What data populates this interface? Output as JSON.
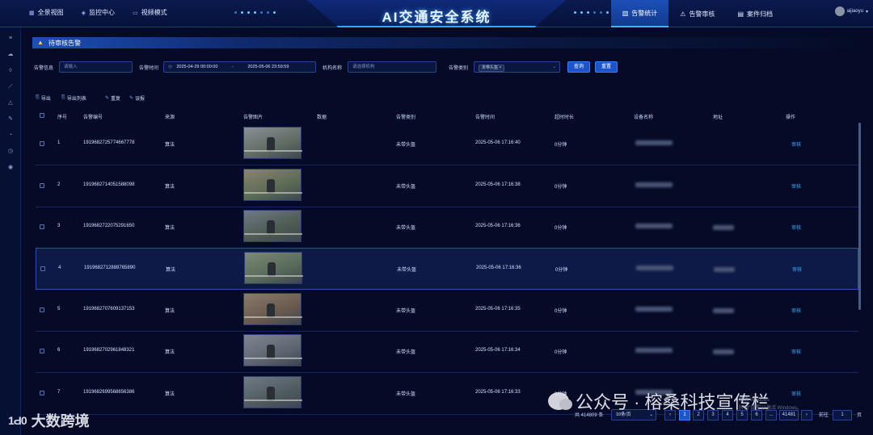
{
  "app": {
    "title": "AI交通安全系统",
    "user": "aijiaoyu"
  },
  "nav_left": [
    {
      "label": "全景视图",
      "icon": "grid-icon"
    },
    {
      "label": "监控中心",
      "icon": "monitor-icon"
    },
    {
      "label": "视频模式",
      "icon": "video-icon"
    }
  ],
  "nav_right": [
    {
      "label": "告警统计",
      "icon": "chart-icon",
      "active": true
    },
    {
      "label": "告警审核",
      "icon": "warning-icon",
      "active": false
    },
    {
      "label": "案件归档",
      "icon": "folder-icon",
      "active": false
    }
  ],
  "section": {
    "title": "待审核告警"
  },
  "filters": {
    "alarm_info_label": "告警信息",
    "alarm_info_placeholder": "请输入",
    "alarm_time_label": "告警时间",
    "time_start": "2025-04-29 00:00:00",
    "time_sep": "-",
    "time_end": "2025-05-06 23:59:59",
    "org_label": "机构名称",
    "org_placeholder": "请选择机构",
    "type_label": "告警类别",
    "type_tag": "未带头盔",
    "query_label": "查询",
    "reset_label": "重置"
  },
  "toolbar": {
    "export": "导出",
    "export_list": "导出列表",
    "reset": "重复",
    "review": "误报"
  },
  "table": {
    "headers": {
      "index": "序号",
      "alarm_id": "告警编号",
      "source": "来源",
      "image": "告警图片",
      "data": "数据",
      "type": "告警类别",
      "time": "告警时间",
      "duration": "超时时长",
      "device": "设备名称",
      "address": "地址",
      "action": "操作"
    },
    "rows": [
      {
        "index": "1",
        "alarm_id": "1919682725774667778",
        "source": "算法",
        "type": "未带头盔",
        "time": "2025-05-06 17:16:40",
        "duration": "0分钟",
        "action": "审核",
        "has_address": false
      },
      {
        "index": "2",
        "alarm_id": "1919682714051588098",
        "source": "算法",
        "type": "未带头盔",
        "time": "2025-05-06 17:16:38",
        "duration": "0分钟",
        "action": "审核",
        "has_address": false
      },
      {
        "index": "3",
        "alarm_id": "1919682722075291650",
        "source": "算法",
        "type": "未带头盔",
        "time": "2025-05-06 17:16:36",
        "duration": "0分钟",
        "action": "审核",
        "has_address": true
      },
      {
        "index": "4",
        "alarm_id": "1919682712889765890",
        "source": "算法",
        "type": "未带头盔",
        "time": "2025-05-06 17:16:36",
        "duration": "0分钟",
        "action": "审核",
        "has_address": true
      },
      {
        "index": "5",
        "alarm_id": "1919682707609137153",
        "source": "算法",
        "type": "未带头盔",
        "time": "2025-05-06 17:16:35",
        "duration": "0分钟",
        "action": "审核",
        "has_address": true
      },
      {
        "index": "6",
        "alarm_id": "1919682702961848321",
        "source": "算法",
        "type": "未带头盔",
        "time": "2025-05-06 17:16:34",
        "duration": "0分钟",
        "action": "审核",
        "has_address": true
      },
      {
        "index": "7",
        "alarm_id": "1919682699568656386",
        "source": "算法",
        "type": "未带头盔",
        "time": "2025-05-06 17:16:33",
        "duration": "0分钟",
        "action": "审核",
        "has_address": false
      }
    ]
  },
  "pagination": {
    "total": "共 414809 条",
    "page_size": "10条/页",
    "pages": [
      "1",
      "2",
      "3",
      "4",
      "5",
      "6",
      "...",
      "41481"
    ],
    "goto_label": "前往",
    "goto_value": "1",
    "page_unit": "页"
  },
  "watermarks": {
    "left_logo": "1Ԁ0",
    "left_text": "大数跨境",
    "right_text": "公众号 · 榕桑科技宣传栏",
    "win_line1": "激活 Windows",
    "win_line2": "转到“设置”以激活 Windows。"
  },
  "colors": {
    "background": "#050b26",
    "accent": "#1b55c9",
    "link": "#3fa8ff",
    "tag_warning": "#ffcf4a"
  }
}
